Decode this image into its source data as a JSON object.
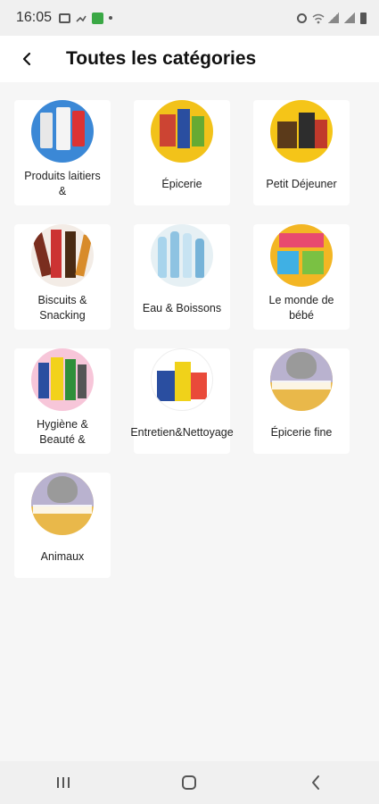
{
  "status_bar": {
    "time": "16:05"
  },
  "header": {
    "title": "Toutes les catégories",
    "back_icon": "back-arrow-icon"
  },
  "categories": [
    {
      "label": "Produits laitiers &",
      "image": "dairy-products-thumbnail"
    },
    {
      "label": "Épicerie",
      "image": "grocery-thumbnail"
    },
    {
      "label": "Petit Déjeuner",
      "image": "breakfast-thumbnail"
    },
    {
      "label": "Biscuits & Snacking",
      "image": "biscuits-thumbnail"
    },
    {
      "label": "Eau & Boissons",
      "image": "water-drinks-thumbnail"
    },
    {
      "label": "Le monde de bébé",
      "image": "baby-world-thumbnail"
    },
    {
      "label": "Hygiène & Beauté &",
      "image": "hygiene-beauty-thumbnail"
    },
    {
      "label": "Entretien&Nettoyage",
      "image": "cleaning-thumbnail"
    },
    {
      "label": "Épicerie fine",
      "image": "fine-grocery-thumbnail"
    },
    {
      "label": "Animaux",
      "image": "pets-thumbnail"
    }
  ],
  "nav_bar": {
    "recents_icon": "recent-apps-icon",
    "home_icon": "home-icon",
    "back_icon": "back-icon"
  },
  "colors": {
    "background": "#f6f6f6",
    "card": "#ffffff",
    "header": "#ffffff",
    "system_bar": "#f0f0f0"
  }
}
